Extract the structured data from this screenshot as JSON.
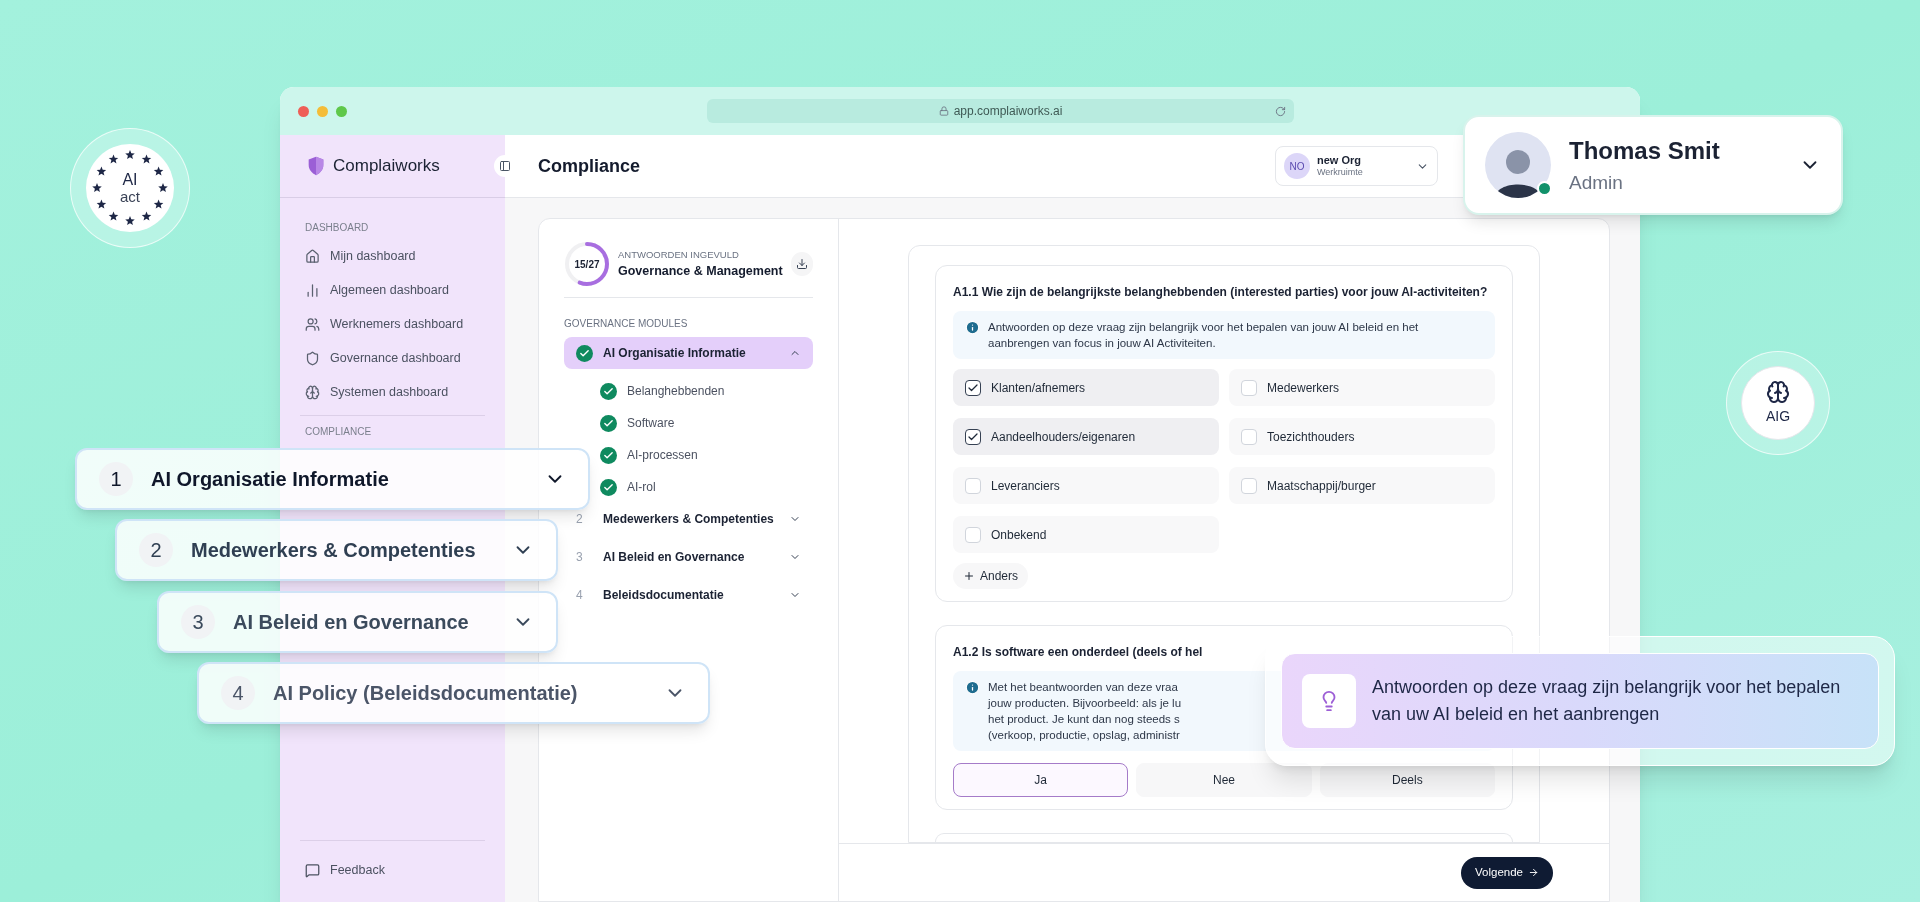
{
  "ai_act_badge": {
    "lines": [
      "AI",
      "act"
    ]
  },
  "aig_badge": {
    "label": "AIG"
  },
  "browser": {
    "url": "app.complaiworks.ai"
  },
  "sidebar": {
    "brand": "Complaiworks",
    "sections": [
      {
        "title": "DASHBOARD",
        "items": [
          "Mijn dashboard",
          "Algemeen dashboard",
          "Werknemers dashboard",
          "Governance dashboard",
          "Systemen dashboard"
        ]
      },
      {
        "title": "COMPLIANCE"
      }
    ],
    "footer_item": "Feedback"
  },
  "header": {
    "title": "Compliance",
    "workspace": {
      "initials": "NO",
      "name": "new Org",
      "type": "Werkruimte"
    }
  },
  "progress": {
    "count": "15/27",
    "level": 0.556,
    "caption": "ANTWOORDEN INGEVULD",
    "title": "Governance & Management"
  },
  "modules": {
    "title": "GOVERNANCE MODULES",
    "items": [
      {
        "label": "AI Organisatie Informatie",
        "done": true,
        "selected": true,
        "expanded": true,
        "children": [
          {
            "label": "Belanghebbenden",
            "done": true
          },
          {
            "label": "Software",
            "done": true
          },
          {
            "label": "AI-processen",
            "done": true
          },
          {
            "label": "AI-rol",
            "done": true
          }
        ]
      },
      {
        "number": "2",
        "label": "Medewerkers & Competenties",
        "done": false,
        "selected": false,
        "expanded": false
      },
      {
        "number": "3",
        "label": "AI Beleid en Governance",
        "done": false,
        "selected": false,
        "expanded": false
      },
      {
        "number": "4",
        "label": "Beleidsdocumentatie",
        "done": false,
        "selected": false,
        "expanded": false
      }
    ]
  },
  "questions": [
    {
      "kind": "checkboxes",
      "title": "A1.1 Wie zijn de belangrijkste belanghebbenden (interested parties) voor jouw AI-activiteiten?",
      "info": [
        "Antwoorden op deze vraag zijn belangrijk voor het bepalen van jouw AI beleid en het",
        "aanbrengen van focus in jouw AI Activiteiten."
      ],
      "options": [
        {
          "label": "Klanten/afnemers",
          "checked": true
        },
        {
          "label": "Medewerkers",
          "checked": false
        },
        {
          "label": "Aandeelhouders/eigenaren",
          "checked": true
        },
        {
          "label": "Toezichthouders",
          "checked": false
        },
        {
          "label": "Leveranciers",
          "checked": false
        },
        {
          "label": "Maatschappij/burger",
          "checked": false
        },
        {
          "label": "Onbekend",
          "checked": false
        }
      ],
      "add_label": "Anders"
    },
    {
      "kind": "choice",
      "title": "A1.2 Is software een onderdeel (deels of hel",
      "info": [
        "Met het beantwoorden van deze vraa",
        "jouw producten. Bijvoorbeeld: als je lu",
        "het product. Je kunt dan nog steeds s",
        "(verkoop, productie, opslag, administr"
      ],
      "options": [
        {
          "label": "Ja",
          "selected": true
        },
        {
          "label": "Nee",
          "selected": false
        },
        {
          "label": "Deels",
          "selected": false
        }
      ]
    }
  ],
  "next_button": "Volgende",
  "tooltip": {
    "text": "Antwoorden op deze vraag zijn belangrijk voor het bepalen van uw AI beleid en het aanbrengen"
  },
  "profile": {
    "name": "Thomas Smit",
    "role": "Admin",
    "online": true
  },
  "floating_modules": [
    {
      "number": "1",
      "label": "AI Organisatie Informatie"
    },
    {
      "number": "2",
      "label": "Medewerkers & Competenties"
    },
    {
      "number": "3",
      "label": "AI Beleid en Governance"
    },
    {
      "number": "4",
      "label": "AI Policy (Beleidsdocumentatie)"
    }
  ]
}
